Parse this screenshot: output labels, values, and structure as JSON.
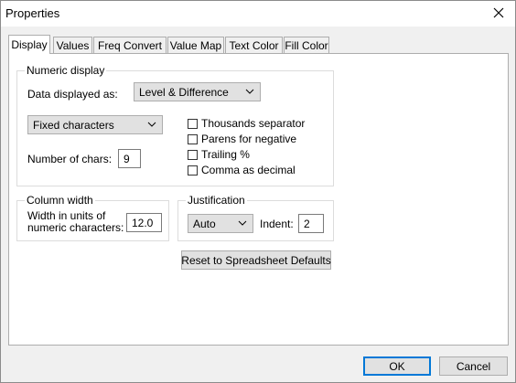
{
  "window": {
    "title": "Properties"
  },
  "tabs": [
    {
      "label": "Display",
      "active": true
    },
    {
      "label": "Values"
    },
    {
      "label": "Freq Convert"
    },
    {
      "label": "Value Map"
    },
    {
      "label": "Text Color"
    },
    {
      "label": "Fill Color"
    }
  ],
  "numeric_display": {
    "group_label": "Numeric display",
    "data_displayed_label": "Data displayed as:",
    "data_displayed_value": "Level & Difference",
    "format_value": "Fixed characters",
    "num_chars_label": "Number of chars:",
    "num_chars_value": "9",
    "checkboxes": [
      {
        "label": "Thousands separator",
        "checked": false
      },
      {
        "label": "Parens for negative",
        "checked": false
      },
      {
        "label": "Trailing %",
        "checked": false
      },
      {
        "label": "Comma as decimal",
        "checked": false
      }
    ]
  },
  "column_width": {
    "group_label": "Column width",
    "line1": "Width in units of",
    "line2": "numeric characters:",
    "value": "12.0"
  },
  "justification": {
    "group_label": "Justification",
    "value": "Auto",
    "indent_label": "Indent:",
    "indent_value": "2"
  },
  "reset_button": "Reset to Spreadsheet Defaults",
  "footer": {
    "ok": "OK",
    "cancel": "Cancel"
  }
}
